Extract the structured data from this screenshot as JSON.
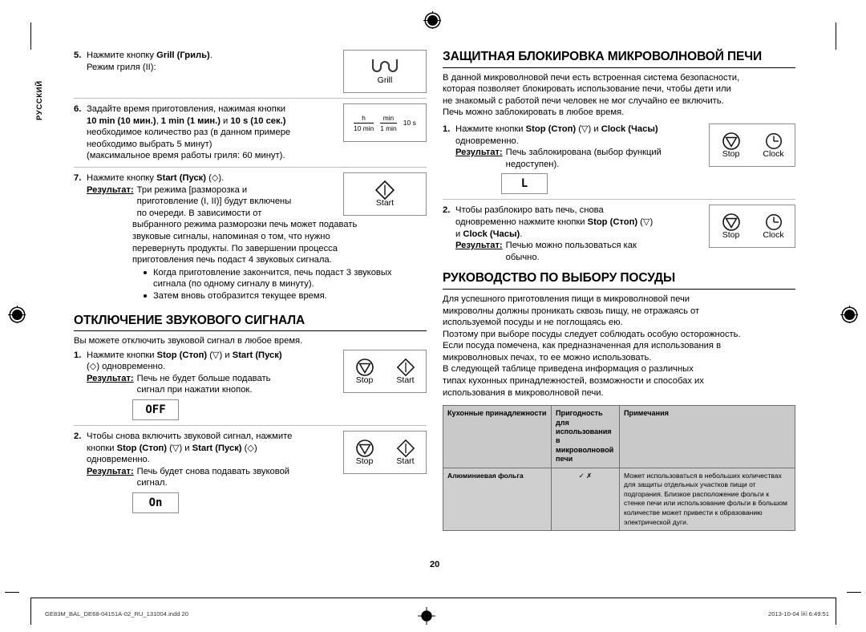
{
  "document": {
    "language_tab": "РУССКИЙ",
    "page_number": "20"
  },
  "left_column": {
    "step5": {
      "num": "5.",
      "line1_prefix": "Нажмите кнопку ",
      "line1_bold": "Grill (Гриль)",
      "line1_suffix": ".",
      "line2": "Режим гриля (II):",
      "art": {
        "type": "grill-key",
        "caption": "Grill"
      }
    },
    "step6": {
      "num": "6.",
      "line1": "Задайте время приготовления, нажимая кнопки",
      "line2_bold_a": "10 min (10 мин.)",
      "line2_sep_a": ", ",
      "line2_bold_b": "1 min (1 мин.)",
      "line2_sep_b": " и ",
      "line2_bold_c": "10 s (10 сек.)",
      "line3": "необходимое количество раз (в данном примере",
      "line4": "необходимо выбрать 5 минут)",
      "line5": "(максимальное время работы гриля: 60 минут).",
      "art": {
        "type": "time-key",
        "keys": [
          {
            "top": "h",
            "bottom": "10 min"
          },
          {
            "top": "min",
            "bottom": "1 min"
          }
        ],
        "third": "10 s"
      }
    },
    "step7": {
      "num": "7.",
      "line1_prefix": "Нажмите кнопку ",
      "line1_bold": "Start (Пуск)",
      "line1_suffix": " (◇).",
      "result_label": "Результат:",
      "result_lines": [
        "Три режима [разморозка и",
        "приготовление (I, II)] будут включены",
        "по очереди. В зависимости от",
        "выбранного режима разморозки печь может подавать",
        "звуковые сигналы, напоминая о том, что нужно",
        "перевернуть продукты. По завершении процесса",
        "приготовления печь подаст 4 звуковых сигнала."
      ],
      "bullets": [
        "Когда приготовление закончится, печь подаст 3 звуковых сигнала (по одному сигналу в минуту).",
        "Затем вновь отобразится текущее время."
      ],
      "art": {
        "type": "start-key",
        "caption": "Start"
      }
    },
    "sound_section": {
      "heading": "ОТКЛЮЧЕНИЕ ЗВУКОВОГО СИГНАЛА",
      "intro": "Вы можете отключить звуковой сигнал в любое время.",
      "step1": {
        "num": "1.",
        "line1_prefix": "Нажмите кнопки ",
        "line1_bold_a": "Stop (Стоп)",
        "line1_mid": " (▽) и ",
        "line1_bold_b": "Start (Пуск)",
        "line2": "(◇) одновременно.",
        "result_label": "Результат:",
        "result_lines": [
          "Печь не будет больше подавать",
          "сигнал при нажатии кнопок."
        ],
        "display": "OFF",
        "art": {
          "type": "stop-start-key",
          "caption_left": "Stop",
          "caption_right": "Start"
        }
      },
      "step2": {
        "num": "2.",
        "line1": "Чтобы снова включить звуковой сигнал, нажмите",
        "line2_prefix": "кнопки ",
        "line2_bold_a": "Stop (Стоп)",
        "line2_mid": " (▽) и ",
        "line2_bold_b": "Start (Пуск)",
        "line2_suffix": " (◇)",
        "line3": "одновременно.",
        "result_label": "Результат:",
        "result_lines": [
          "Печь будет снова подавать звуковой",
          "сигнал."
        ],
        "display": "On",
        "art": {
          "type": "stop-start-key",
          "caption_left": "Stop",
          "caption_right": "Start"
        }
      }
    }
  },
  "right_column": {
    "lock_section": {
      "heading": "ЗАЩИТНАЯ БЛОКИРОВКА МИКРОВОЛНОВОЙ ПЕЧИ",
      "intro_lines": [
        "В данной микроволновой печи есть встроенная система безопасности,",
        "которая позволяет блокировать использование печи, чтобы дети или",
        "не знакомый с работой печи человек не мог случайно ее включить.",
        "Печь можно заблокировать в любое время."
      ],
      "step1": {
        "num": "1.",
        "line1_prefix": "Нажмите кнопки ",
        "line1_bold_a": "Stop (Стоп)",
        "line1_mid": " (▽) и ",
        "line1_bold_b": "Clock (Часы)",
        "line2": "одновременно.",
        "result_label": "Результат:",
        "result_lines": [
          "Печь заблокирована (выбор функций",
          "недоступен)."
        ],
        "display": "L",
        "art": {
          "type": "stop-clock-key",
          "caption_left": "Stop",
          "caption_right": "Clock"
        }
      },
      "step2": {
        "num": "2.",
        "line1": "Чтобы разблокиро вать печь, снова",
        "line2_prefix": "одновременно нажмите кнопки ",
        "line2_bold": "Stop (Стоп)",
        "line2_suffix": " (▽)",
        "line3_prefix": "и ",
        "line3_bold": "Clock (Часы)",
        "line3_suffix": ".",
        "result_label": "Результат:",
        "result_lines": [
          "Печью можно пользоваться как",
          "обычно."
        ],
        "art": {
          "type": "stop-clock-key",
          "caption_left": "Stop",
          "caption_right": "Clock"
        }
      }
    },
    "cookware_section": {
      "heading": "РУКОВОДСТВО ПО ВЫБОРУ ПОСУДЫ",
      "paragraph_lines": [
        "Для успешного приготовления пищи в микроволновой печи",
        "микроволны должны проникать сквозь пищу, не отражаясь от",
        "используемой посуды и не поглощаясь ею.",
        "Поэтому при выборе посуды следует соблюдать особую осторожность.",
        "Если посуда помечена, как предназначенная для использования в",
        "микроволновых печах, то ее можно использовать.",
        "В следующей таблице приведена информация о различных",
        "типах кухонных принадлежностей, возможности и способах их",
        "использования в микроволновой печи."
      ],
      "table": {
        "headers": [
          "Кухонные принадлежности",
          "Пригодность для использования в микроволновой печи",
          "Примечания"
        ],
        "rows": [
          {
            "name": "Алюминиевая фольга",
            "suitability": "✓ ✗",
            "note": "Может использоваться в небольших количествах для защиты отдельных участков пищи от подгорания. Близкое расположение фольги к стенке печи или использование фольги в большом количестве может привести к образованию электрической дуги."
          }
        ]
      }
    }
  },
  "footer": {
    "file_name": "GE83M_BAL_DE68-04151A-02_RU_131004.indd   20",
    "timestamp": "2013-10-04   ￼ 6:49:51"
  }
}
